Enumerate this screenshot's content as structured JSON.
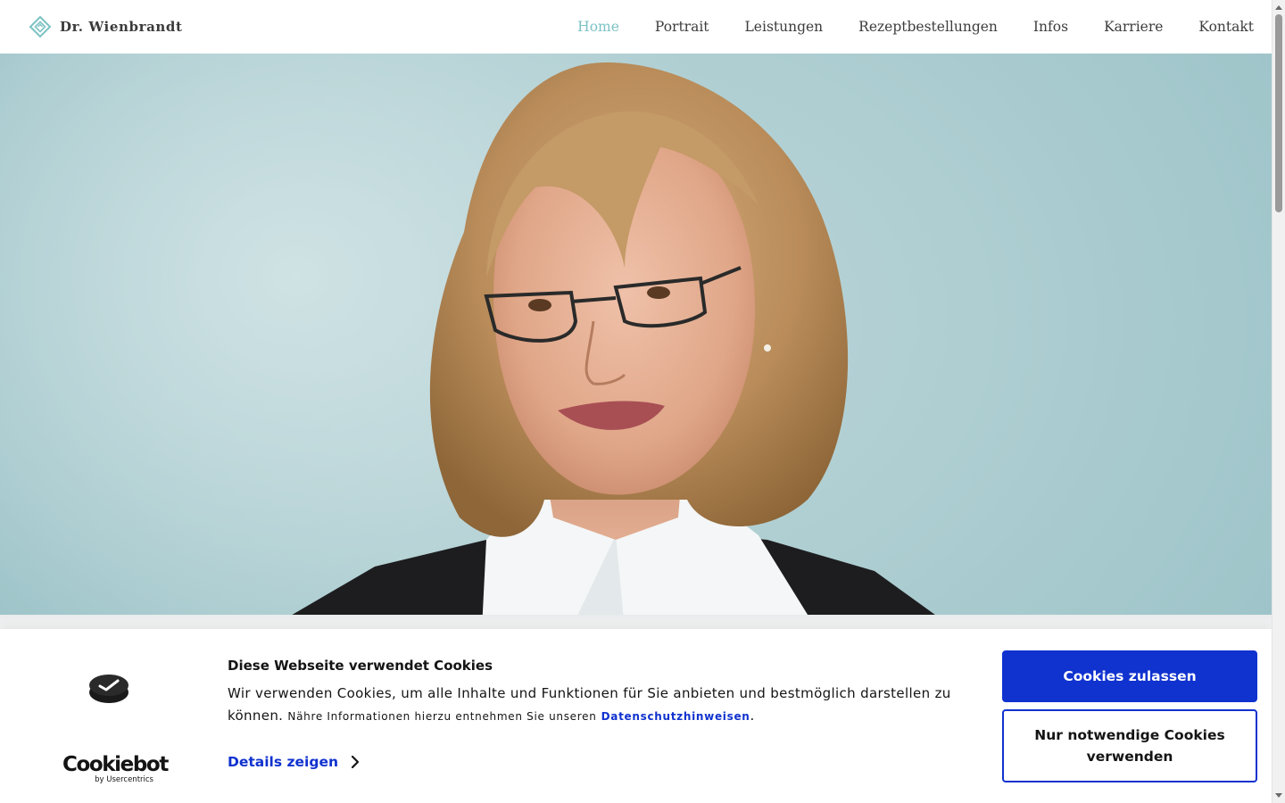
{
  "header": {
    "brand": "Dr. Wienbrandt",
    "nav": [
      {
        "label": "Home",
        "active": true
      },
      {
        "label": "Portrait",
        "active": false
      },
      {
        "label": "Leistungen",
        "active": false
      },
      {
        "label": "Rezeptbestellungen",
        "active": false
      },
      {
        "label": "Infos",
        "active": false
      },
      {
        "label": "Karriere",
        "active": false
      },
      {
        "label": "Kontakt",
        "active": false
      }
    ],
    "accent_color": "#7cc2c4"
  },
  "hero": {
    "image": "portrait-photo"
  },
  "cookie_banner": {
    "logo_wordmark": "Cookiebot",
    "logo_sub": "by Usercentrics",
    "title": "Diese Webseite verwendet Cookies",
    "text_main": "Wir verwenden Cookies, um alle Inhalte und Funktionen für Sie anbieten und bestmöglich darstellen zu können.",
    "text_small": "Nähre Informationen hierzu entnehmen Sie unseren",
    "privacy_link": "Datenschutzhinweisen",
    "text_end": ".",
    "details_label": "Details zeigen",
    "allow_button": "Cookies zulassen",
    "necessary_button": "Nur notwendige Cookies verwenden",
    "button_color": "#1032cf"
  }
}
